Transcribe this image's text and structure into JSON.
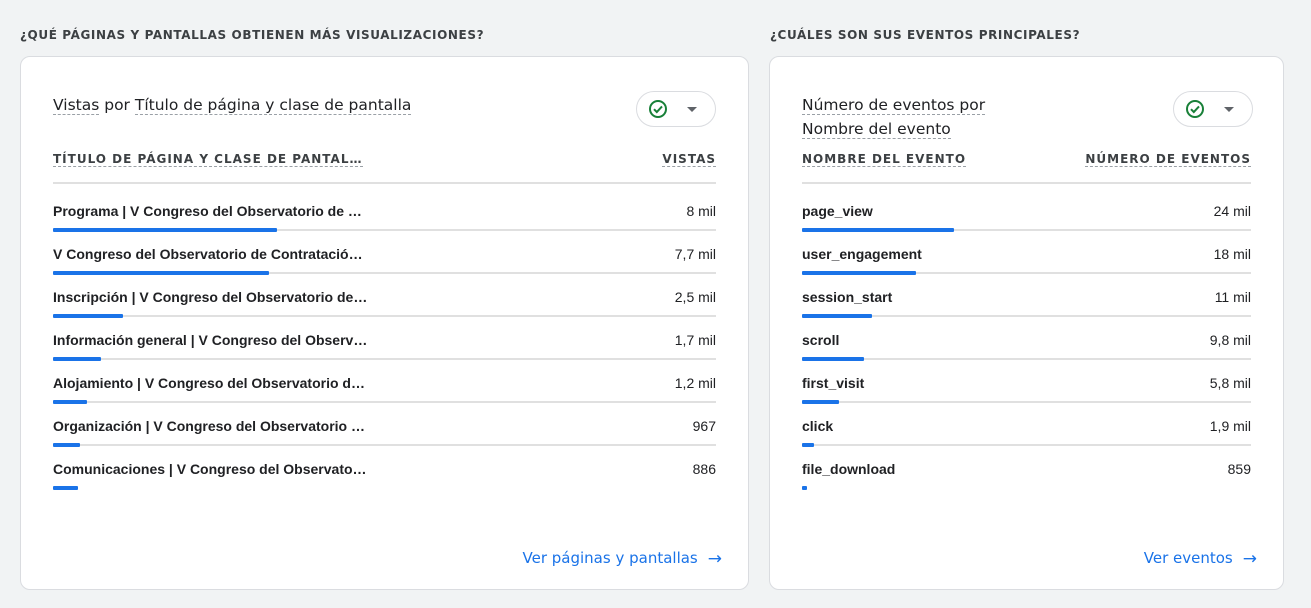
{
  "left": {
    "section_title": "¿QUÉ PÁGINAS Y PANTALLAS OBTIENEN MÁS VISUALIZACIONES?",
    "card_title_prefix": "Vistas",
    "card_title_mid": " por ",
    "card_title_dim": "Título de página y clase de pantalla",
    "col_label": "TÍTULO DE PÁGINA Y CLASE DE PANTAL…",
    "col_value": "VISTAS",
    "rows": [
      {
        "label": "Programa | V Congreso del Observatorio de …",
        "value": "8 mil",
        "fraction": 1.0
      },
      {
        "label": "V Congreso del Observatorio de Contratació…",
        "value": "7,7 mil",
        "fraction": 0.9625
      },
      {
        "label": "Inscripción | V Congreso del Observatorio de…",
        "value": "2,5 mil",
        "fraction": 0.3125
      },
      {
        "label": "Información general | V Congreso del Observ…",
        "value": "1,7 mil",
        "fraction": 0.2125
      },
      {
        "label": "Alojamiento | V Congreso del Observatorio d…",
        "value": "1,2 mil",
        "fraction": 0.15
      },
      {
        "label": "Organización | V Congreso del Observatorio …",
        "value": "967",
        "fraction": 0.121
      },
      {
        "label": "Comunicaciones | V Congreso del Observato…",
        "value": "886",
        "fraction": 0.111
      }
    ],
    "link": "Ver páginas y pantallas"
  },
  "right": {
    "section_title": "¿CUÁLES SON SUS EVENTOS PRINCIPALES?",
    "card_title_line1": "Número de eventos por",
    "card_title_line2": "Nombre del evento",
    "col_label": "NOMBRE DEL EVENTO",
    "col_value": "NÚMERO DE EVENTOS",
    "rows": [
      {
        "label": "page_view",
        "value": "24 mil",
        "fraction": 1.0
      },
      {
        "label": "user_engagement",
        "value": "18 mil",
        "fraction": 0.75
      },
      {
        "label": "session_start",
        "value": "11 mil",
        "fraction": 0.458
      },
      {
        "label": "scroll",
        "value": "9,8 mil",
        "fraction": 0.408
      },
      {
        "label": "first_visit",
        "value": "5,8 mil",
        "fraction": 0.242
      },
      {
        "label": "click",
        "value": "1,9 mil",
        "fraction": 0.079
      },
      {
        "label": "file_download",
        "value": "859",
        "fraction": 0.036
      }
    ],
    "link": "Ver eventos"
  },
  "colors": {
    "accent": "#1a73e8",
    "check": "#188038"
  },
  "icons": {
    "status": "check-circle-icon",
    "dropdown": "caret-down-icon",
    "link": "arrow-right-icon"
  }
}
